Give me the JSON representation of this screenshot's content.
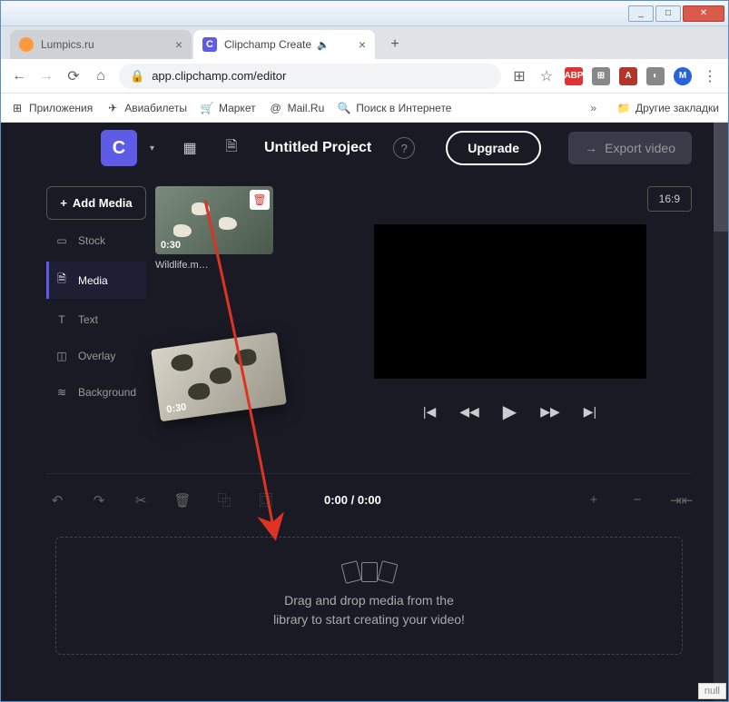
{
  "window": {
    "min": "_",
    "max": "□",
    "close": "✕"
  },
  "tabs": [
    {
      "favClass": "orange",
      "favText": "",
      "title": "Lumpics.ru",
      "active": false
    },
    {
      "favClass": "purple",
      "favText": "C",
      "title": "Clipchamp Create",
      "audio": "🔈",
      "active": true
    }
  ],
  "newtab": "+",
  "addr": {
    "back": "←",
    "fwd": "→",
    "reload": "⟳",
    "home": "⌂",
    "lock": "🔒",
    "url": "app.clipchamp.com/editor",
    "translate": "⊞",
    "star": "☆",
    "ext": [
      {
        "cls": "red",
        "t": "ABP"
      },
      {
        "cls": "grey",
        "t": "⊞"
      },
      {
        "cls": "adobe",
        "t": "A"
      },
      {
        "cls": "grey",
        "t": "◐"
      },
      {
        "cls": "blue",
        "t": "M"
      }
    ],
    "menu": "⋮"
  },
  "bookmarks": [
    {
      "ico": "⊞",
      "label": "Приложения"
    },
    {
      "ico": "✈",
      "label": "Авиабилеты"
    },
    {
      "ico": "🛒",
      "label": "Маркет"
    },
    {
      "ico": "@",
      "label": "Mail.Ru"
    },
    {
      "ico": "🔍",
      "label": "Поиск в Интернете"
    }
  ],
  "bm_more": "»",
  "bm_other": "Другие закладки",
  "header": {
    "logo": "C",
    "drop": "▾",
    "title": "Untitled Project",
    "help": "?",
    "upgrade": "Upgrade",
    "export": "Export video",
    "export_arrow": "→"
  },
  "sidebar": {
    "add": "Add Media",
    "items": [
      {
        "ico": "▭",
        "label": "Stock"
      },
      {
        "ico": "🗎",
        "label": "Media",
        "active": true
      },
      {
        "ico": "T",
        "label": "Text"
      },
      {
        "ico": "◫",
        "label": "Overlay"
      },
      {
        "ico": "≋",
        "label": "Background"
      }
    ]
  },
  "media": {
    "duration": "0:30",
    "name": "Wildlife.m…",
    "delete": "🗑"
  },
  "dragclip": {
    "duration": "0:30"
  },
  "preview": {
    "aspect": "16:9"
  },
  "controls": {
    "start": "|◀",
    "rew": "◀◀",
    "play": "▶",
    "ff": "▶▶",
    "end": "▶|"
  },
  "timeline": {
    "undo": "↶",
    "redo": "↷",
    "cut": "✂",
    "delete": "🗑",
    "copy": "⿻",
    "dup": "⿴",
    "time": "0:00 / 0:00",
    "zoomin": "+",
    "zoomout": "−",
    "fit": "⇥⇤"
  },
  "dropzone": {
    "line1": "Drag and drop media from the",
    "line2": "library to start creating your video!"
  },
  "null": "null"
}
